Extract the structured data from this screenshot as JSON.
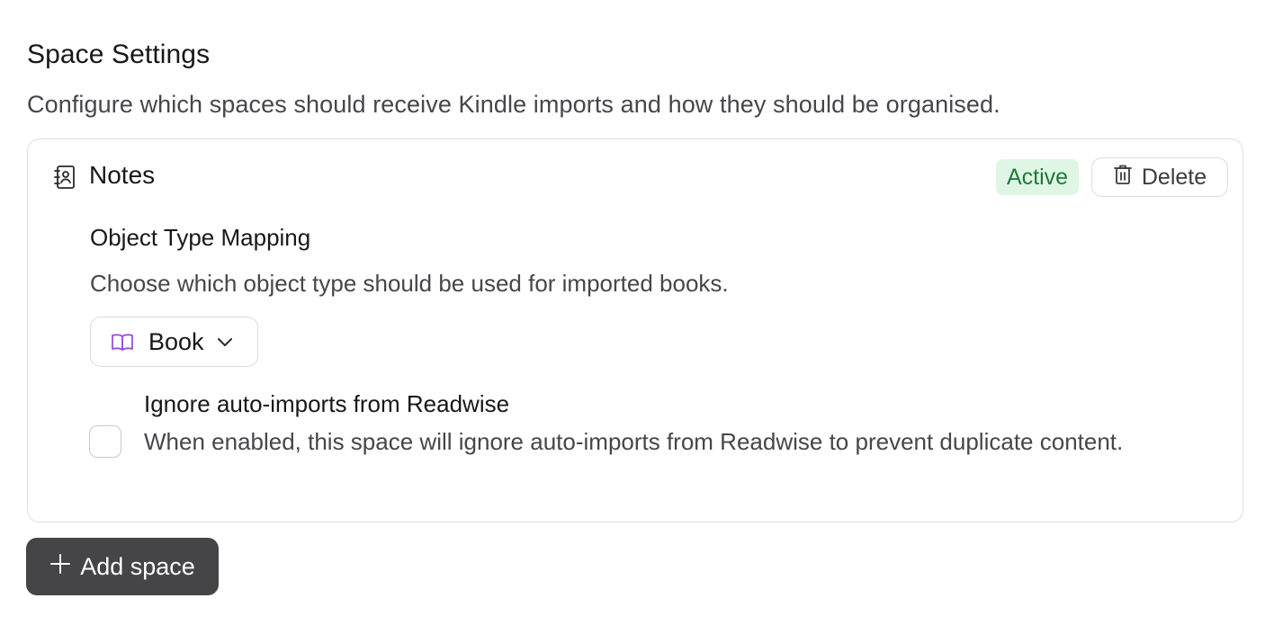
{
  "section": {
    "title": "Space Settings",
    "description": "Configure which spaces should receive Kindle imports and how they should be organised."
  },
  "space": {
    "icon": "contact-book-icon",
    "name": "Notes",
    "status": "Active",
    "delete_label": "Delete",
    "object_type_mapping": {
      "title": "Object Type Mapping",
      "description": "Choose which object type should be used for imported books.",
      "selected_icon": "book-icon",
      "selected_value": "Book"
    },
    "ignore_readwise": {
      "checked": false,
      "title": "Ignore auto-imports from Readwise",
      "description": "When enabled, this space will ignore auto-imports from Readwise to prevent duplicate content."
    }
  },
  "add_space_label": "Add space",
  "colors": {
    "active_badge_bg": "#dff6e5",
    "active_badge_text": "#1e7a3c",
    "book_icon": "#9b4ede",
    "primary_button_bg": "#454547"
  }
}
